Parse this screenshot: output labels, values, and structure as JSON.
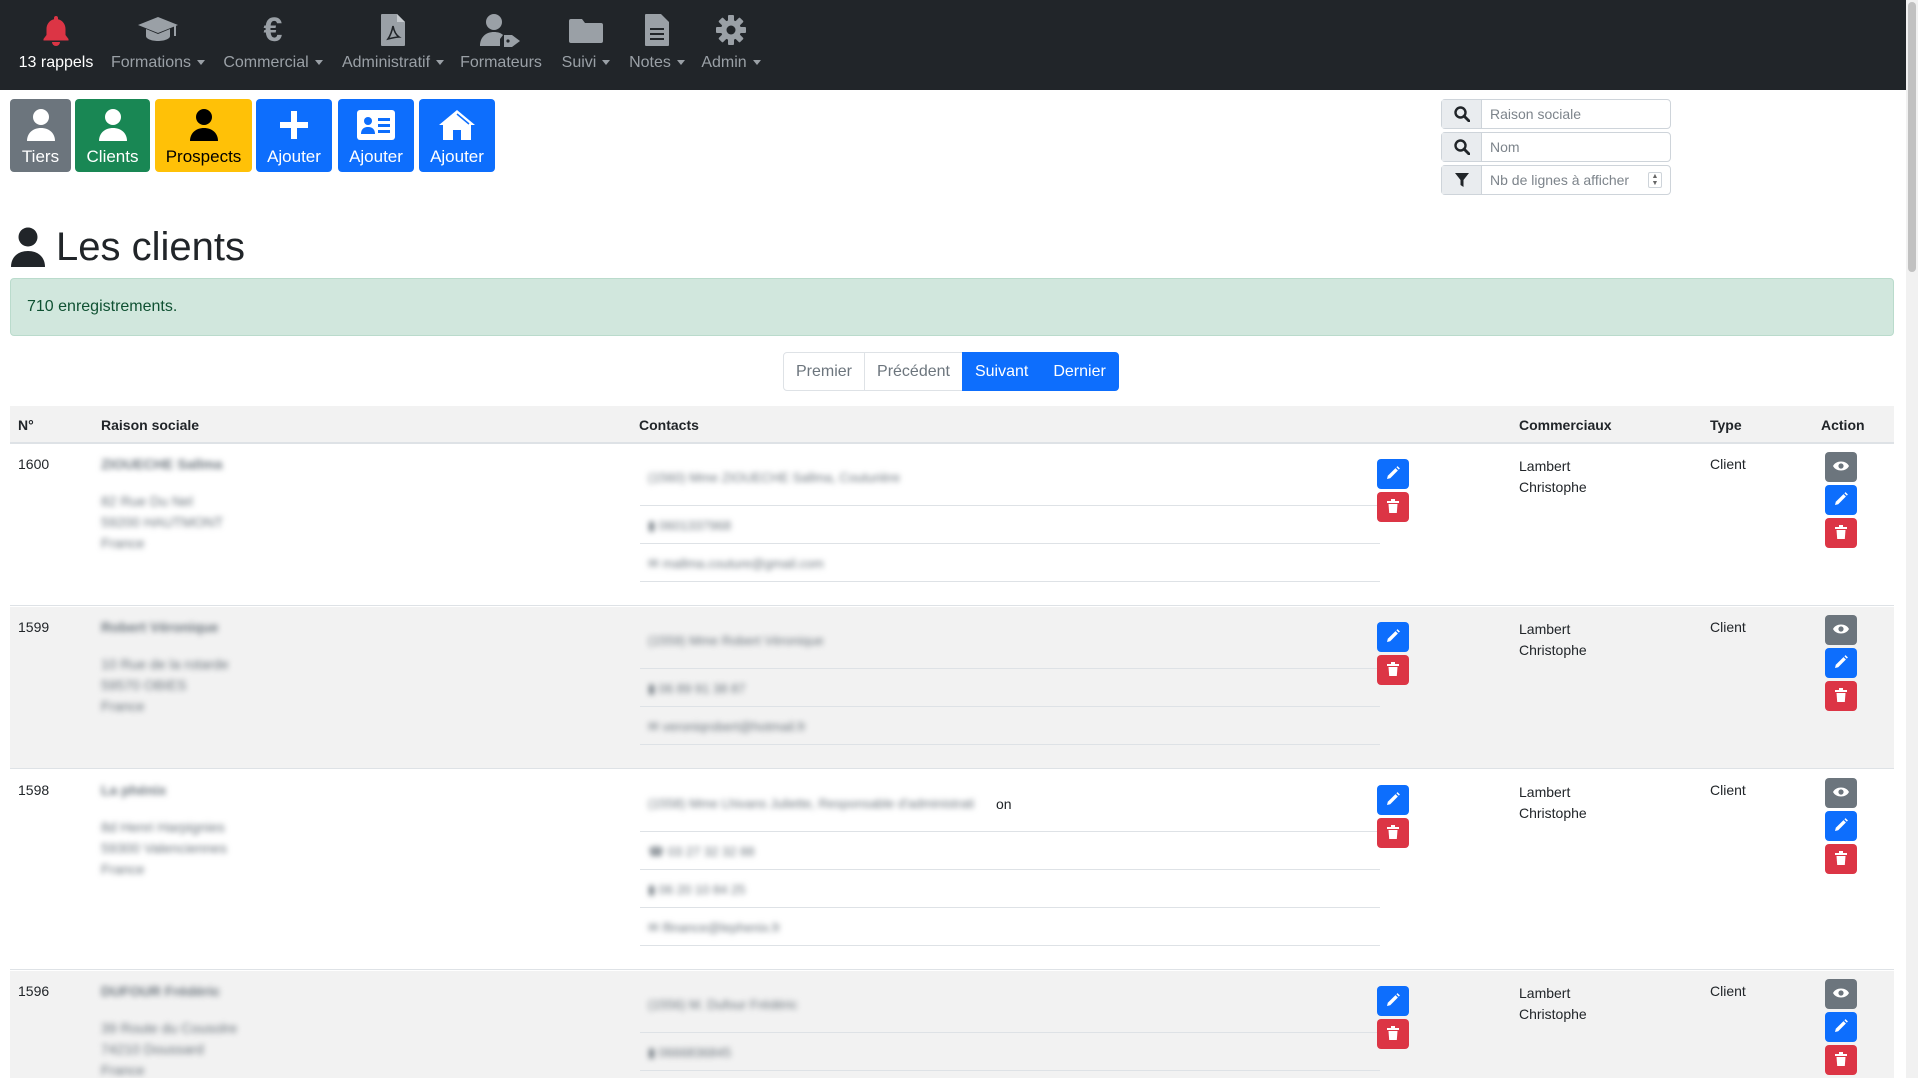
{
  "nav": {
    "rappels": "13 rappels",
    "formations": "Formations",
    "commercial": "Commercial",
    "administratif": "Administratif",
    "formateurs": "Formateurs",
    "suivi": "Suivi",
    "notes": "Notes",
    "admin": "Admin"
  },
  "tiles": {
    "tiers": "Tiers",
    "clients": "Clients",
    "prospects": "Prospects",
    "ajouter1": "Ajouter",
    "ajouter2": "Ajouter",
    "ajouter3": "Ajouter"
  },
  "search": {
    "raison_placeholder": "Raison sociale",
    "nom_placeholder": "Nom",
    "lignes_placeholder": "Nb de lignes à afficher"
  },
  "page": {
    "title": "Les clients",
    "count": "710 enregistrements."
  },
  "pagination": {
    "premier": "Premier",
    "precedent": "Précédent",
    "suivant": "Suivant",
    "dernier": "Dernier"
  },
  "table": {
    "headers": {
      "num": "N°",
      "raison": "Raison sociale",
      "contacts": "Contacts",
      "commerciaux": "Commerciaux",
      "type": "Type",
      "action": "Action"
    },
    "rows": [
      {
        "num": "1600",
        "name": "ZIOUECHE Sallma",
        "addr1": "82 Rue Du Nel",
        "addr2": "59200 HAUTMONT",
        "addr3": "France",
        "contact": "(1560) Mme ZIOUECHE Sallma, Couturière",
        "phone": "0601337968",
        "email": "mallma.couture@gmail.com",
        "sales1": "Lambert",
        "sales2": "Christophe",
        "type": "Client"
      },
      {
        "num": "1599",
        "name": "Robert Véronique",
        "addr1": "10 Rue de la rotarde",
        "addr2": "59570 OBIES",
        "addr3": "France",
        "contact": "(1559) Mme Robert Véronique",
        "phone": "06 89 91 38 87",
        "email": "veroniqrobert@hotmail.fr",
        "sales1": "Lambert",
        "sales2": "Christophe",
        "type": "Client"
      },
      {
        "num": "1598",
        "name": "La phénix",
        "addr1": "8d Henri Harpignies",
        "addr2": "59300 Valenciennes",
        "addr3": "France",
        "contact": "(1558) Mme Lhivans Juliette, Responsable d'administrati",
        "contact_tail": "on",
        "fixed": "03 27 32 32 88",
        "phone": "06 20 10 84 25",
        "email": "lfinance@lephenix.fr",
        "sales1": "Lambert",
        "sales2": "Christophe",
        "type": "Client"
      },
      {
        "num": "1596",
        "name": "DUFOUR Frédéric",
        "addr1": "39 Route du Cousolre",
        "addr2": "74210 Doussard",
        "addr3": "France",
        "contact": "(1556) M. Dufour Frédéric",
        "phone": "0666836845",
        "sales1": "Lambert",
        "sales2": "Christophe",
        "type": "Client"
      }
    ]
  }
}
